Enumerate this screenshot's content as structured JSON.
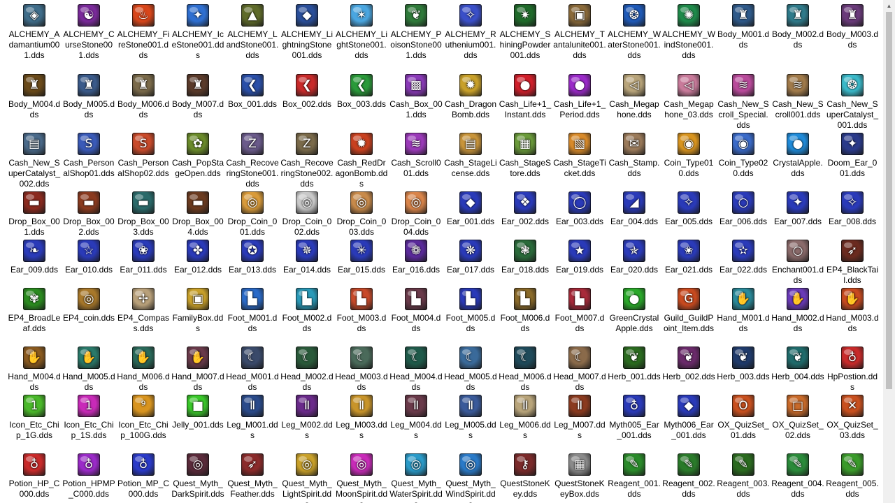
{
  "scrollbar": {
    "up_glyph": "▲",
    "down_glyph": "▼"
  },
  "rows": [
    [
      {
        "label": "ALCHEMY_Adamantium001.dds",
        "icon": "adamantium-ore-icon",
        "color": "#3f6d8a",
        "glyph": "◈"
      },
      {
        "label": "ALCHEMY_CurseStone001.dds",
        "icon": "curse-stone-icon",
        "color": "#7a2a9a",
        "glyph": "☯"
      },
      {
        "label": "ALCHEMY_FireStone001.dds",
        "icon": "fire-stone-icon",
        "color": "#d8461a",
        "glyph": "♨"
      },
      {
        "label": "ALCHEMY_IceStone001.dds",
        "icon": "ice-stone-icon",
        "color": "#2f6fd0",
        "glyph": "✦"
      },
      {
        "label": "ALCHEMY_LandStone001.dds",
        "icon": "land-stone-icon",
        "color": "#5f6b2a",
        "glyph": "▲"
      },
      {
        "label": "ALCHEMY_LightningStone001.dds",
        "icon": "lightning-stone-icon",
        "color": "#2a4f9a",
        "glyph": "◆"
      },
      {
        "label": "ALCHEMY_LightStone001.dds",
        "icon": "light-stone-icon",
        "color": "#4aa6e0",
        "glyph": "✶"
      },
      {
        "label": "ALCHEMY_PoisonStone001.dds",
        "icon": "poison-stone-icon",
        "color": "#2f7a3a",
        "glyph": "❦"
      },
      {
        "label": "ALCHEMY_Ruthenium001.dds",
        "icon": "ruthenium-icon",
        "color": "#3a4fc8",
        "glyph": "✧"
      },
      {
        "label": "ALCHEMY_ShiningPowder001.dds",
        "icon": "shining-powder-icon",
        "color": "#1f6a2a",
        "glyph": "✷"
      },
      {
        "label": "ALCHEMY_Tantalunite001.dds",
        "icon": "tantalunite-icon",
        "color": "#8a6a3a",
        "glyph": "▣"
      },
      {
        "label": "ALCHEMY_WaterStone001.dds",
        "icon": "water-stone-icon",
        "color": "#1f5ab8",
        "glyph": "❂"
      },
      {
        "label": "ALCHEMY_WindStone001.dds",
        "icon": "wind-stone-icon",
        "color": "#1f8a4a",
        "glyph": "✺"
      },
      {
        "label": "Body_M001.dds",
        "icon": "body-armor-icon",
        "color": "#2f5a8a",
        "glyph": "♜"
      },
      {
        "label": "Body_M002.dds",
        "icon": "body-armor-icon",
        "color": "#2f7a8a",
        "glyph": "♜"
      },
      {
        "label": "Body_M003.dds",
        "icon": "body-armor-icon",
        "color": "#6a3a7a",
        "glyph": "♜"
      }
    ],
    [
      {
        "label": "Body_M004.dds",
        "icon": "body-armor-icon",
        "color": "#6a4a1a",
        "glyph": "♜"
      },
      {
        "label": "Body_M005.dds",
        "icon": "body-armor-icon",
        "color": "#3a5a8a",
        "glyph": "♜"
      },
      {
        "label": "Body_M006.dds",
        "icon": "body-armor-icon",
        "color": "#7a6a4a",
        "glyph": "♜"
      },
      {
        "label": "Body_M007.dds",
        "icon": "body-armor-icon",
        "color": "#5a3a2a",
        "glyph": "♜"
      },
      {
        "label": "Box_001.dds",
        "icon": "box-icon",
        "color": "#2a4fa8",
        "glyph": "❮"
      },
      {
        "label": "Box_002.dds",
        "icon": "box-icon",
        "color": "#c82a2a",
        "glyph": "❮"
      },
      {
        "label": "Box_003.dds",
        "icon": "box-icon",
        "color": "#2a9a3a",
        "glyph": "❮"
      },
      {
        "label": "Cash_Box_001.dds",
        "icon": "gift-box-icon",
        "color": "#8a3ab8",
        "glyph": "▩"
      },
      {
        "label": "Cash_DragonBomb.dds",
        "icon": "dragon-bomb-icon",
        "color": "#c8a02a",
        "glyph": "✹"
      },
      {
        "label": "Cash_Life+1_Instant.dds",
        "icon": "life-balloon-icon",
        "color": "#d01f2a",
        "glyph": "●"
      },
      {
        "label": "Cash_Life+1_Period.dds",
        "icon": "life-balloon-icon",
        "color": "#9a2ac8",
        "glyph": "●"
      },
      {
        "label": "Cash_Megaphone.dds",
        "icon": "megaphone-icon",
        "color": "#b8a47a",
        "glyph": "◁"
      },
      {
        "label": "Cash_Megaphone_03.dds",
        "icon": "megaphone-icon",
        "color": "#c87a9a",
        "glyph": "◁"
      },
      {
        "label": "Cash_New_Scroll_Special.dds",
        "icon": "scroll-icon",
        "color": "#b84a9a",
        "glyph": "≋"
      },
      {
        "label": "Cash_New_Scroll001.dds",
        "icon": "scroll-icon",
        "color": "#a07a4a",
        "glyph": "≋"
      },
      {
        "label": "Cash_New_SuperCatalyst_001.dds",
        "icon": "catalyst-icon",
        "color": "#3ab8c8",
        "glyph": "❂"
      }
    ],
    [
      {
        "label": "Cash_New_SuperCatalyst_002.dds",
        "icon": "catalyst-book-icon",
        "color": "#4a6a8a",
        "glyph": "▤"
      },
      {
        "label": "Cash_PersonalShop01.dds",
        "icon": "personal-shop-icon",
        "color": "#3a5ab8",
        "glyph": "S"
      },
      {
        "label": "Cash_PersonalShop02.dds",
        "icon": "personal-shop-icon",
        "color": "#c84a2a",
        "glyph": "S"
      },
      {
        "label": "Cash_PopStageOpen.dds",
        "icon": "stage-open-icon",
        "color": "#6a8a2a",
        "glyph": "✿"
      },
      {
        "label": "Cash_RecoveringStone001.dds",
        "icon": "recovering-stone-icon",
        "color": "#6a5a8a",
        "glyph": "Z"
      },
      {
        "label": "Cash_RecoveringStone002.dds",
        "icon": "recovering-stone-icon",
        "color": "#7a6a4a",
        "glyph": "Z"
      },
      {
        "label": "Cash_RedDragonBomb.dds",
        "icon": "red-dragon-bomb-icon",
        "color": "#c8401f",
        "glyph": "✹"
      },
      {
        "label": "Cash_Scroll001.dds",
        "icon": "scroll-icon",
        "color": "#9a3ab8",
        "glyph": "≋"
      },
      {
        "label": "Cash_StageLicense.dds",
        "icon": "license-icon",
        "color": "#c8943a",
        "glyph": "▤"
      },
      {
        "label": "Cash_StageStore.dds",
        "icon": "store-basket-icon",
        "color": "#6a9a3a",
        "glyph": "▦"
      },
      {
        "label": "Cash_StageTicket.dds",
        "icon": "ticket-icon",
        "color": "#d88a2a",
        "glyph": "▧"
      },
      {
        "label": "Cash_Stamp.dds",
        "icon": "stamp-icon",
        "color": "#9a7a5a",
        "glyph": "✉"
      },
      {
        "label": "Coin_Type010.dds",
        "icon": "coin-icon",
        "color": "#d8941f",
        "glyph": "◉"
      },
      {
        "label": "Coin_Type020.dds",
        "icon": "coin-icon",
        "color": "#3a6ac8",
        "glyph": "◉"
      },
      {
        "label": "CrystalApple.dds",
        "icon": "crystal-apple-icon",
        "color": "#1f8ad8",
        "glyph": "●"
      },
      {
        "label": "Doom_Ear_001.dds",
        "icon": "earring-icon",
        "color": "#2a3a8a",
        "glyph": "✦"
      }
    ],
    [
      {
        "label": "Drop_Box_001.dds",
        "icon": "treasure-chest-icon",
        "color": "#8a2a1f",
        "glyph": "▬"
      },
      {
        "label": "Drop_Box_002.dds",
        "icon": "treasure-chest-icon",
        "color": "#8a3a1f",
        "glyph": "▬"
      },
      {
        "label": "Drop_Box_003.dds",
        "icon": "treasure-chest-icon",
        "color": "#2a6a6a",
        "glyph": "▬"
      },
      {
        "label": "Drop_Box_004.dds",
        "icon": "treasure-chest-icon",
        "color": "#6a3a1f",
        "glyph": "▬"
      },
      {
        "label": "Drop_Coin_001.dds",
        "icon": "coin-icon",
        "color": "#d89a3a",
        "glyph": "◎"
      },
      {
        "label": "Drop_Coin_002.dds",
        "icon": "coin-icon",
        "color": "#c8c8c8",
        "glyph": "◎"
      },
      {
        "label": "Drop_Coin_003.dds",
        "icon": "coin-icon",
        "color": "#c88a4a",
        "glyph": "◎"
      },
      {
        "label": "Drop_Coin_004.dds",
        "icon": "coin-icon",
        "color": "#d8844a",
        "glyph": "◎"
      },
      {
        "label": "Ear_001.dds",
        "icon": "earring-icon",
        "color": "#2a3ab8",
        "glyph": "◆"
      },
      {
        "label": "Ear_002.dds",
        "icon": "earring-icon",
        "color": "#2a3ab8",
        "glyph": "❖"
      },
      {
        "label": "Ear_003.dds",
        "icon": "earring-icon",
        "color": "#2a3ab8",
        "glyph": "◯"
      },
      {
        "label": "Ear_004.dds",
        "icon": "earring-icon",
        "color": "#2a3ab8",
        "glyph": "◢"
      },
      {
        "label": "Ear_005.dds",
        "icon": "earring-icon",
        "color": "#2a3ab8",
        "glyph": "✧"
      },
      {
        "label": "Ear_006.dds",
        "icon": "earring-icon",
        "color": "#2a3ab8",
        "glyph": "○"
      },
      {
        "label": "Ear_007.dds",
        "icon": "earring-icon",
        "color": "#2a3ab8",
        "glyph": "✦"
      },
      {
        "label": "Ear_008.dds",
        "icon": "earring-icon",
        "color": "#2a3ab8",
        "glyph": "✧"
      }
    ],
    [
      {
        "label": "Ear_009.dds",
        "icon": "earring-icon",
        "color": "#2a3ab8",
        "glyph": "❧"
      },
      {
        "label": "Ear_010.dds",
        "icon": "earring-icon",
        "color": "#2a3ab8",
        "glyph": "☆"
      },
      {
        "label": "Ear_011.dds",
        "icon": "earring-icon",
        "color": "#2a3ab8",
        "glyph": "❀"
      },
      {
        "label": "Ear_012.dds",
        "icon": "earring-icon",
        "color": "#2a3ab8",
        "glyph": "✤"
      },
      {
        "label": "Ear_013.dds",
        "icon": "earring-icon",
        "color": "#2a3ab8",
        "glyph": "✪"
      },
      {
        "label": "Ear_014.dds",
        "icon": "earring-icon",
        "color": "#2a3ab8",
        "glyph": "✵"
      },
      {
        "label": "Ear_015.dds",
        "icon": "earring-icon",
        "color": "#2a3ab8",
        "glyph": "✳"
      },
      {
        "label": "Ear_016.dds",
        "icon": "earring-icon",
        "color": "#5a2a9a",
        "glyph": "❁"
      },
      {
        "label": "Ear_017.dds",
        "icon": "earring-icon",
        "color": "#2a3ab8",
        "glyph": "❋"
      },
      {
        "label": "Ear_018.dds",
        "icon": "earring-icon",
        "color": "#2a6a3a",
        "glyph": "❃"
      },
      {
        "label": "Ear_019.dds",
        "icon": "earring-icon",
        "color": "#2a3ab8",
        "glyph": "★"
      },
      {
        "label": "Ear_020.dds",
        "icon": "earring-icon",
        "color": "#2a3ab8",
        "glyph": "✯"
      },
      {
        "label": "Ear_021.dds",
        "icon": "earring-icon",
        "color": "#2a3ab8",
        "glyph": "✬"
      },
      {
        "label": "Ear_022.dds",
        "icon": "earring-icon",
        "color": "#2a3ab8",
        "glyph": "✫"
      },
      {
        "label": "Enchant001.dds",
        "icon": "magnifier-icon",
        "color": "#8a6a6a",
        "glyph": "○"
      },
      {
        "label": "EP4_BlackTail.dds",
        "icon": "black-tail-icon",
        "color": "#6a2a1f",
        "glyph": "➶"
      }
    ],
    [
      {
        "label": "EP4_BroadLeaf.dds",
        "icon": "leaf-icon",
        "color": "#2a8a1f",
        "glyph": "✾"
      },
      {
        "label": "EP4_coin.dds",
        "icon": "coin-icon",
        "color": "#a8782a",
        "glyph": "◎"
      },
      {
        "label": "EP4_Compass.dds",
        "icon": "compass-icon",
        "color": "#b8a07a",
        "glyph": "✢"
      },
      {
        "label": "FamilyBox.dds",
        "icon": "family-box-icon",
        "color": "#c8a02a",
        "glyph": "▣"
      },
      {
        "label": "Foot_M001.dds",
        "icon": "boots-icon",
        "color": "#2a6ac8",
        "glyph": "▙"
      },
      {
        "label": "Foot_M002.dds",
        "icon": "boots-icon",
        "color": "#2a9ab8",
        "glyph": "▙"
      },
      {
        "label": "Foot_M003.dds",
        "icon": "boots-icon",
        "color": "#c84a2a",
        "glyph": "▙"
      },
      {
        "label": "Foot_M004.dds",
        "icon": "boots-icon",
        "color": "#6a3a4a",
        "glyph": "▙"
      },
      {
        "label": "Foot_M005.dds",
        "icon": "boots-icon",
        "color": "#2a3ab8",
        "glyph": "▙"
      },
      {
        "label": "Foot_M006.dds",
        "icon": "boots-icon",
        "color": "#8a6a2a",
        "glyph": "▙"
      },
      {
        "label": "Foot_M007.dds",
        "icon": "boots-icon",
        "color": "#a82a3a",
        "glyph": "▙"
      },
      {
        "label": "GreenCrystalApple.dds",
        "icon": "green-apple-icon",
        "color": "#2aa82a",
        "glyph": "●"
      },
      {
        "label": "Guild_GuildPoint_Item.dds",
        "icon": "guild-point-icon",
        "color": "#c84a1f",
        "glyph": "G"
      },
      {
        "label": "Hand_M001.dds",
        "icon": "gloves-icon",
        "color": "#2a8a9a",
        "glyph": "✋"
      },
      {
        "label": "Hand_M002.dds",
        "icon": "gloves-icon",
        "color": "#6a3ab8",
        "glyph": "✋"
      },
      {
        "label": "Hand_M003.dds",
        "icon": "gloves-icon",
        "color": "#c84a1f",
        "glyph": "✋"
      }
    ],
    [
      {
        "label": "Hand_M004.dds",
        "icon": "gloves-icon",
        "color": "#8a5a1f",
        "glyph": "✋"
      },
      {
        "label": "Hand_M005.dds",
        "icon": "gloves-icon",
        "color": "#2a7a6a",
        "glyph": "✋"
      },
      {
        "label": "Hand_M006.dds",
        "icon": "gloves-icon",
        "color": "#2a6a5a",
        "glyph": "✋"
      },
      {
        "label": "Hand_M007.dds",
        "icon": "gloves-icon",
        "color": "#6a3a4a",
        "glyph": "✋"
      },
      {
        "label": "Head_M001.dds",
        "icon": "helmet-icon",
        "color": "#3a4a6a",
        "glyph": "☾"
      },
      {
        "label": "Head_M002.dds",
        "icon": "helmet-icon",
        "color": "#2a5a3a",
        "glyph": "☾"
      },
      {
        "label": "Head_M003.dds",
        "icon": "helmet-icon",
        "color": "#4a6a5a",
        "glyph": "☾"
      },
      {
        "label": "Head_M004.dds",
        "icon": "helmet-icon",
        "color": "#1f5a4a",
        "glyph": "☾"
      },
      {
        "label": "Head_M005.dds",
        "icon": "helmet-icon",
        "color": "#3a6a9a",
        "glyph": "☾"
      },
      {
        "label": "Head_M006.dds",
        "icon": "helmet-icon",
        "color": "#1f4a5a",
        "glyph": "☾"
      },
      {
        "label": "Head_M007.dds",
        "icon": "helmet-icon",
        "color": "#8a6a4a",
        "glyph": "☾"
      },
      {
        "label": "Herb_001.dds",
        "icon": "herb-icon",
        "color": "#2a6a1f",
        "glyph": "❦"
      },
      {
        "label": "Herb_002.dds",
        "icon": "herb-icon",
        "color": "#6a2a6a",
        "glyph": "❦"
      },
      {
        "label": "Herb_003.dds",
        "icon": "herb-icon",
        "color": "#1f3a6a",
        "glyph": "❦"
      },
      {
        "label": "Herb_004.dds",
        "icon": "herb-icon",
        "color": "#1f6a6a",
        "glyph": "❦"
      },
      {
        "label": "HpPostion.dds",
        "icon": "potion-icon",
        "color": "#c82a2a",
        "glyph": "♁"
      }
    ],
    [
      {
        "label": "Icon_Etc_Chip_1G.dds",
        "icon": "chip-icon",
        "color": "#4ab82a",
        "glyph": "1"
      },
      {
        "label": "Icon_Etc_Chip_1S.dds",
        "icon": "chip-icon",
        "color": "#c82ab8",
        "glyph": "1"
      },
      {
        "label": "Icon_Etc_Chip_100G.dds",
        "icon": "chip-icon",
        "color": "#d8941f",
        "glyph": "⁹"
      },
      {
        "label": "Jelly_001.dds",
        "icon": "jelly-icon",
        "color": "#3ac82a",
        "glyph": "■"
      },
      {
        "label": "Leg_M001.dds",
        "icon": "leggings-icon",
        "color": "#2a4a8a",
        "glyph": "Ⅱ"
      },
      {
        "label": "Leg_M002.dds",
        "icon": "leggings-icon",
        "color": "#6a2a8a",
        "glyph": "Ⅱ"
      },
      {
        "label": "Leg_M003.dds",
        "icon": "leggings-icon",
        "color": "#c8942a",
        "glyph": "Ⅱ"
      },
      {
        "label": "Leg_M004.dds",
        "icon": "leggings-icon",
        "color": "#6a3a4a",
        "glyph": "Ⅱ"
      },
      {
        "label": "Leg_M005.dds",
        "icon": "leggings-icon",
        "color": "#3a5a9a",
        "glyph": "Ⅱ"
      },
      {
        "label": "Leg_M006.dds",
        "icon": "leggings-icon",
        "color": "#b8a47a",
        "glyph": "Ⅱ"
      },
      {
        "label": "Leg_M007.dds",
        "icon": "leggings-icon",
        "color": "#8a3a1f",
        "glyph": "Ⅱ"
      },
      {
        "label": "Myth005_Ear_001.dds",
        "icon": "myth-earring-icon",
        "color": "#2a3ab8",
        "glyph": "♁"
      },
      {
        "label": "Myth006_Ear_001.dds",
        "icon": "myth-earring-icon",
        "color": "#2a3ab8",
        "glyph": "◆"
      },
      {
        "label": "OX_QuizSet_01.dds",
        "icon": "quiz-card-icon",
        "color": "#c8501f",
        "glyph": "O"
      },
      {
        "label": "OX_QuizSet_02.dds",
        "icon": "quiz-card-icon",
        "color": "#c86a2a",
        "glyph": "□"
      },
      {
        "label": "OX_QuizSet_03.dds",
        "icon": "quiz-card-icon",
        "color": "#c8501f",
        "glyph": "✕"
      }
    ],
    [
      {
        "label": "Potion_HP_C000.dds",
        "icon": "potion-icon",
        "color": "#c82a2a",
        "glyph": "♁"
      },
      {
        "label": "Potion_HPMP_C000.dds",
        "icon": "potion-icon",
        "color": "#9a2ac8",
        "glyph": "♁"
      },
      {
        "label": "Potion_MP_C000.dds",
        "icon": "potion-icon",
        "color": "#2a3ac8",
        "glyph": "♁"
      },
      {
        "label": "Quest_Myth_DarkSpirit.dds",
        "icon": "spirit-orb-icon",
        "color": "#5a2a3a",
        "glyph": "◎"
      },
      {
        "label": "Quest_Myth_Feather.dds",
        "icon": "feather-icon",
        "color": "#8a2a2a",
        "glyph": "➶"
      },
      {
        "label": "Quest_Myth_LightSpirit.dds",
        "icon": "spirit-orb-icon",
        "color": "#c8a02a",
        "glyph": "◎"
      },
      {
        "label": "Quest_Myth_MoonSpirit.dds",
        "icon": "spirit-orb-icon",
        "color": "#c82ab8",
        "glyph": "◎"
      },
      {
        "label": "Quest_Myth_WaterSpirit.dds",
        "icon": "spirit-orb-icon",
        "color": "#2a9ac8",
        "glyph": "◎"
      },
      {
        "label": "Quest_Myth_WindSpirit.dds",
        "icon": "spirit-orb-icon",
        "color": "#2a7ac8",
        "glyph": "◎"
      },
      {
        "label": "QuestStoneKey.dds",
        "icon": "key-icon",
        "color": "#7a2a2a",
        "glyph": "⚷"
      },
      {
        "label": "QuestStoneKeyBox.dds",
        "icon": "stone-box-icon",
        "color": "#8a8a8a",
        "glyph": "▦"
      },
      {
        "label": "Reagent_001.dds",
        "icon": "reagent-icon",
        "color": "#2a8a2a",
        "glyph": "✎"
      },
      {
        "label": "Reagent_002.dds",
        "icon": "reagent-icon",
        "color": "#2a7a2a",
        "glyph": "✎"
      },
      {
        "label": "Reagent_003.dds",
        "icon": "reagent-icon",
        "color": "#2a6a1f",
        "glyph": "✎"
      },
      {
        "label": "Reagent_004.dds",
        "icon": "reagent-icon",
        "color": "#2a8a3a",
        "glyph": "✎"
      },
      {
        "label": "Reagent_005.dds",
        "icon": "reagent-icon",
        "color": "#3a9a2a",
        "glyph": "✎"
      }
    ]
  ]
}
